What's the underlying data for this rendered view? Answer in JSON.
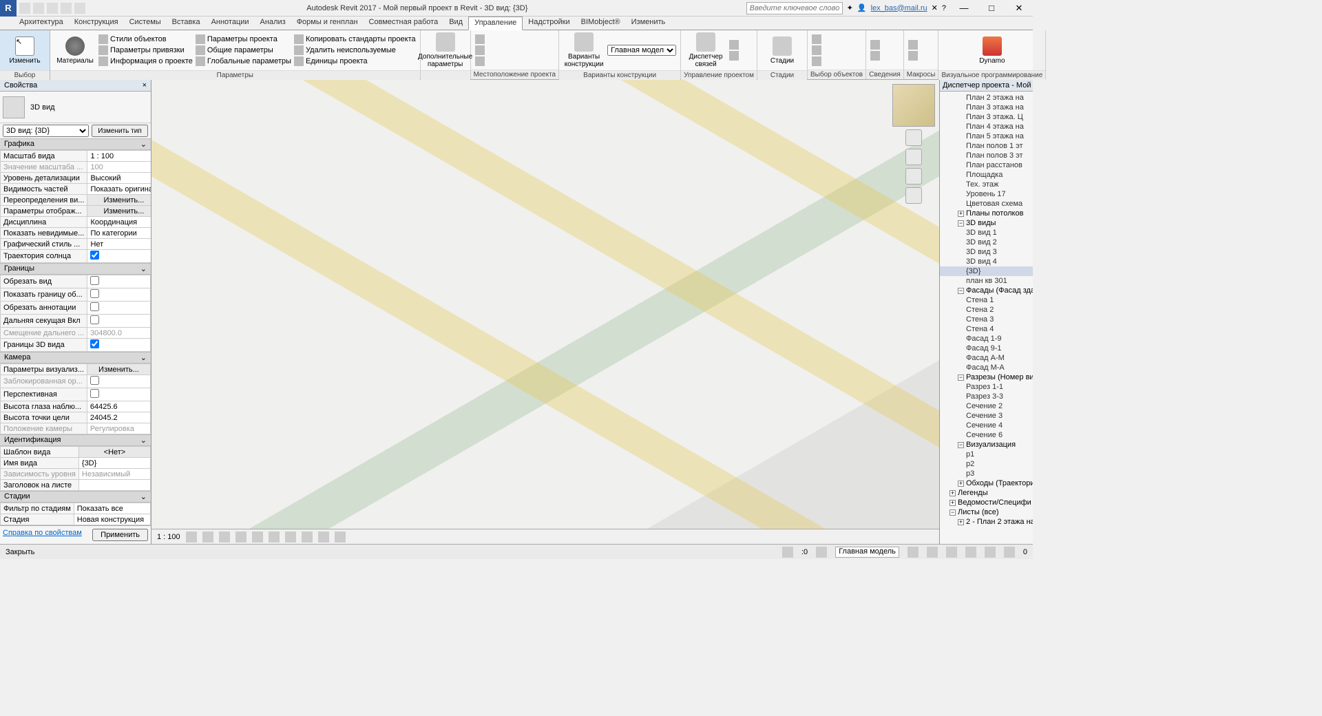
{
  "title": "Autodesk Revit 2017 -    Мой первый проект в Revit - 3D вид: {3D}",
  "search_placeholder": "Введите ключевое слово/фразу",
  "user": "lex_bas@mail.ru",
  "tabs": [
    "Архитектура",
    "Конструкция",
    "Системы",
    "Вставка",
    "Аннотации",
    "Анализ",
    "Формы и генплан",
    "Совместная работа",
    "Вид",
    "Управление",
    "Надстройки",
    "BIMobject®",
    "Изменить"
  ],
  "active_tab": 9,
  "ribbon": {
    "modify": "Изменить",
    "materials": "Материалы",
    "params_col": [
      "Стили объектов",
      "Параметры привязки",
      "Информация о проекте"
    ],
    "params_col2": [
      "Параметры проекта",
      "Общие параметры",
      "Глобальные  параметры"
    ],
    "params_col3": [
      "Копировать стандарты проекта",
      "Удалить неиспользуемые",
      "Единицы проекта"
    ],
    "panel_params": "Параметры",
    "addl": "Дополнительные\nпараметры",
    "loc": "Местоположение проекта",
    "variants": "Варианты\nконструкции",
    "main_model": "Главная модель",
    "panel_variants": "Варианты конструкции",
    "links": "Диспетчер\nсвязей",
    "panel_mgr": "Управление проектом",
    "stages": "Стадии",
    "panel_stages": "Стадии",
    "panel_sel": "Выбор объектов",
    "panel_info": "Сведения",
    "panel_macros": "Макросы",
    "dynamo": "Dynamo",
    "panel_vprog": "Визуальное программирование",
    "selector": "Выбор"
  },
  "props": {
    "title": "Свойства",
    "viewtype": "3D вид",
    "type_combo": "3D вид: {3D}",
    "edit_type": "Изменить тип",
    "groups": {
      "g1": "Графика",
      "g2": "Границы",
      "g3": "Камера",
      "g4": "Идентификация",
      "g5": "Стадии"
    },
    "rows": {
      "r1": [
        "Масштаб вида",
        "1 : 100"
      ],
      "r2": [
        "Значение масштаба ...",
        "100"
      ],
      "r3": [
        "Уровень детализации",
        "Высокий"
      ],
      "r4": [
        "Видимость частей",
        "Показать оригинал"
      ],
      "r5": [
        "Переопределения ви...",
        "Изменить..."
      ],
      "r6": [
        "Параметры отображ...",
        "Изменить..."
      ],
      "r7": [
        "Дисциплина",
        "Координация"
      ],
      "r8": [
        "Показать невидимые...",
        "По категории"
      ],
      "r9": [
        "Графический стиль ...",
        "Нет"
      ],
      "r10": [
        "Траектория солнца",
        ""
      ],
      "r11": [
        "Обрезать вид",
        ""
      ],
      "r12": [
        "Показать границу об...",
        ""
      ],
      "r13": [
        "Обрезать аннотации",
        ""
      ],
      "r14": [
        "Дальняя секущая Вкл",
        ""
      ],
      "r15": [
        "Смещение дальнего ...",
        "304800.0"
      ],
      "r16": [
        "Границы 3D вида",
        ""
      ],
      "r17": [
        "Параметры визуализ...",
        "Изменить..."
      ],
      "r18": [
        "Заблокированная ор...",
        ""
      ],
      "r19": [
        "Перспективная",
        ""
      ],
      "r20": [
        "Высота глаза наблю...",
        "64425.6"
      ],
      "r21": [
        "Высота точки цели",
        "24045.2"
      ],
      "r22": [
        "Положение камеры",
        "Регулировка"
      ],
      "r23": [
        "Шаблон вида",
        "<Нет>"
      ],
      "r24": [
        "Имя вида",
        "{3D}"
      ],
      "r25": [
        "Зависимость уровня",
        "Независимый"
      ],
      "r26": [
        "Заголовок на листе",
        ""
      ],
      "r27": [
        "Фильтр по стадиям",
        "Показать все"
      ],
      "r28": [
        "Стадия",
        "Новая конструкция"
      ]
    },
    "help": "Справка по свойствам",
    "apply": "Применить"
  },
  "viewbar_scale": "1 : 100",
  "browser": {
    "title": "Диспетчер проекта - Мой ...",
    "nodes": [
      {
        "l": 3,
        "t": "План 2 этажа на"
      },
      {
        "l": 3,
        "t": "План 3 этажа на"
      },
      {
        "l": 3,
        "t": "План 3 этажа. Ц"
      },
      {
        "l": 3,
        "t": "План 4 этажа на"
      },
      {
        "l": 3,
        "t": "План 5 этажа на"
      },
      {
        "l": 3,
        "t": "План полов 1 эт"
      },
      {
        "l": 3,
        "t": "План полов 3 эт"
      },
      {
        "l": 3,
        "t": "План расстанов"
      },
      {
        "l": 3,
        "t": "Площадка"
      },
      {
        "l": 3,
        "t": "Тех. этаж"
      },
      {
        "l": 3,
        "t": "Уровень 17"
      },
      {
        "l": 3,
        "t": "Цветовая схема"
      },
      {
        "l": 2,
        "t": "Планы потолков",
        "e": "+"
      },
      {
        "l": 2,
        "t": "3D виды",
        "e": "−"
      },
      {
        "l": 3,
        "t": "3D вид 1"
      },
      {
        "l": 3,
        "t": "3D вид 2"
      },
      {
        "l": 3,
        "t": "3D вид 3"
      },
      {
        "l": 3,
        "t": "3D вид 4"
      },
      {
        "l": 3,
        "t": "{3D}",
        "sel": true
      },
      {
        "l": 3,
        "t": "план кв 301"
      },
      {
        "l": 2,
        "t": "Фасады (Фасад здан",
        "e": "−"
      },
      {
        "l": 3,
        "t": "Стена 1"
      },
      {
        "l": 3,
        "t": "Стена 2"
      },
      {
        "l": 3,
        "t": "Стена 3"
      },
      {
        "l": 3,
        "t": "Стена 4"
      },
      {
        "l": 3,
        "t": "Фасад 1-9"
      },
      {
        "l": 3,
        "t": "Фасад 9-1"
      },
      {
        "l": 3,
        "t": "Фасад А-М"
      },
      {
        "l": 3,
        "t": "Фасад М-А"
      },
      {
        "l": 2,
        "t": "Разрезы (Номер вид",
        "e": "−"
      },
      {
        "l": 3,
        "t": "Разрез 1-1"
      },
      {
        "l": 3,
        "t": "Разрез 3-3"
      },
      {
        "l": 3,
        "t": "Сечение 2"
      },
      {
        "l": 3,
        "t": "Сечение 3"
      },
      {
        "l": 3,
        "t": "Сечение 4"
      },
      {
        "l": 3,
        "t": "Сечение 6"
      },
      {
        "l": 2,
        "t": "Визуализация",
        "e": "−"
      },
      {
        "l": 3,
        "t": "р1"
      },
      {
        "l": 3,
        "t": "р2"
      },
      {
        "l": 3,
        "t": "р3"
      },
      {
        "l": 2,
        "t": "Обходы (Траектори",
        "e": "+"
      },
      {
        "l": 1,
        "t": "Легенды",
        "e": "+"
      },
      {
        "l": 1,
        "t": "Ведомости/Специфи",
        "e": "+"
      },
      {
        "l": 1,
        "t": "Листы (все)",
        "e": "−"
      },
      {
        "l": 2,
        "t": "2 - План 2 этажа на",
        "e": "+"
      }
    ]
  },
  "status": {
    "left": "Закрыть",
    "sel_count": ":0",
    "model": "Главная модель"
  }
}
